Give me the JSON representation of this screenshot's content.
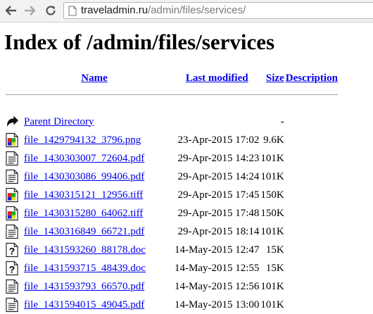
{
  "browser": {
    "url_host": "traveladmin.ru",
    "url_path": "/admin/files/services/"
  },
  "page": {
    "title": "Index of /admin/files/services"
  },
  "table": {
    "headers": {
      "name": "Name",
      "last_modified": "Last modified",
      "size": "Size",
      "description": "Description"
    },
    "parent": {
      "name": "Parent Directory",
      "size": "-"
    },
    "rows": [
      {
        "icon": "image-icon",
        "name": "file_1429794132_3796.png",
        "modified": "23-Apr-2015 17:02",
        "size": "9.6K"
      },
      {
        "icon": "text-file-icon",
        "name": "file_1430303007_72604.pdf",
        "modified": "29-Apr-2015 14:23",
        "size": "101K"
      },
      {
        "icon": "text-file-icon",
        "name": "file_1430303086_99406.pdf",
        "modified": "29-Apr-2015 14:24",
        "size": "101K"
      },
      {
        "icon": "image-icon",
        "name": "file_1430315121_12956.tiff",
        "modified": "29-Apr-2015 17:45",
        "size": "150K"
      },
      {
        "icon": "image-icon",
        "name": "file_1430315280_64062.tiff",
        "modified": "29-Apr-2015 17:48",
        "size": "150K"
      },
      {
        "icon": "text-file-icon",
        "name": "file_1430316849_66721.pdf",
        "modified": "29-Apr-2015 18:14",
        "size": "101K"
      },
      {
        "icon": "unknown-file-icon",
        "name": "file_1431593260_88178.doc",
        "modified": "14-May-2015 12:47",
        "size": "15K"
      },
      {
        "icon": "unknown-file-icon",
        "name": "file_1431593715_48439.doc",
        "modified": "14-May-2015 12:55",
        "size": "15K"
      },
      {
        "icon": "text-file-icon",
        "name": "file_1431593793_66570.pdf",
        "modified": "14-May-2015 12:56",
        "size": "101K"
      },
      {
        "icon": "text-file-icon",
        "name": "file_1431594015_49045.pdf",
        "modified": "14-May-2015 13:00",
        "size": "101K"
      }
    ]
  }
}
